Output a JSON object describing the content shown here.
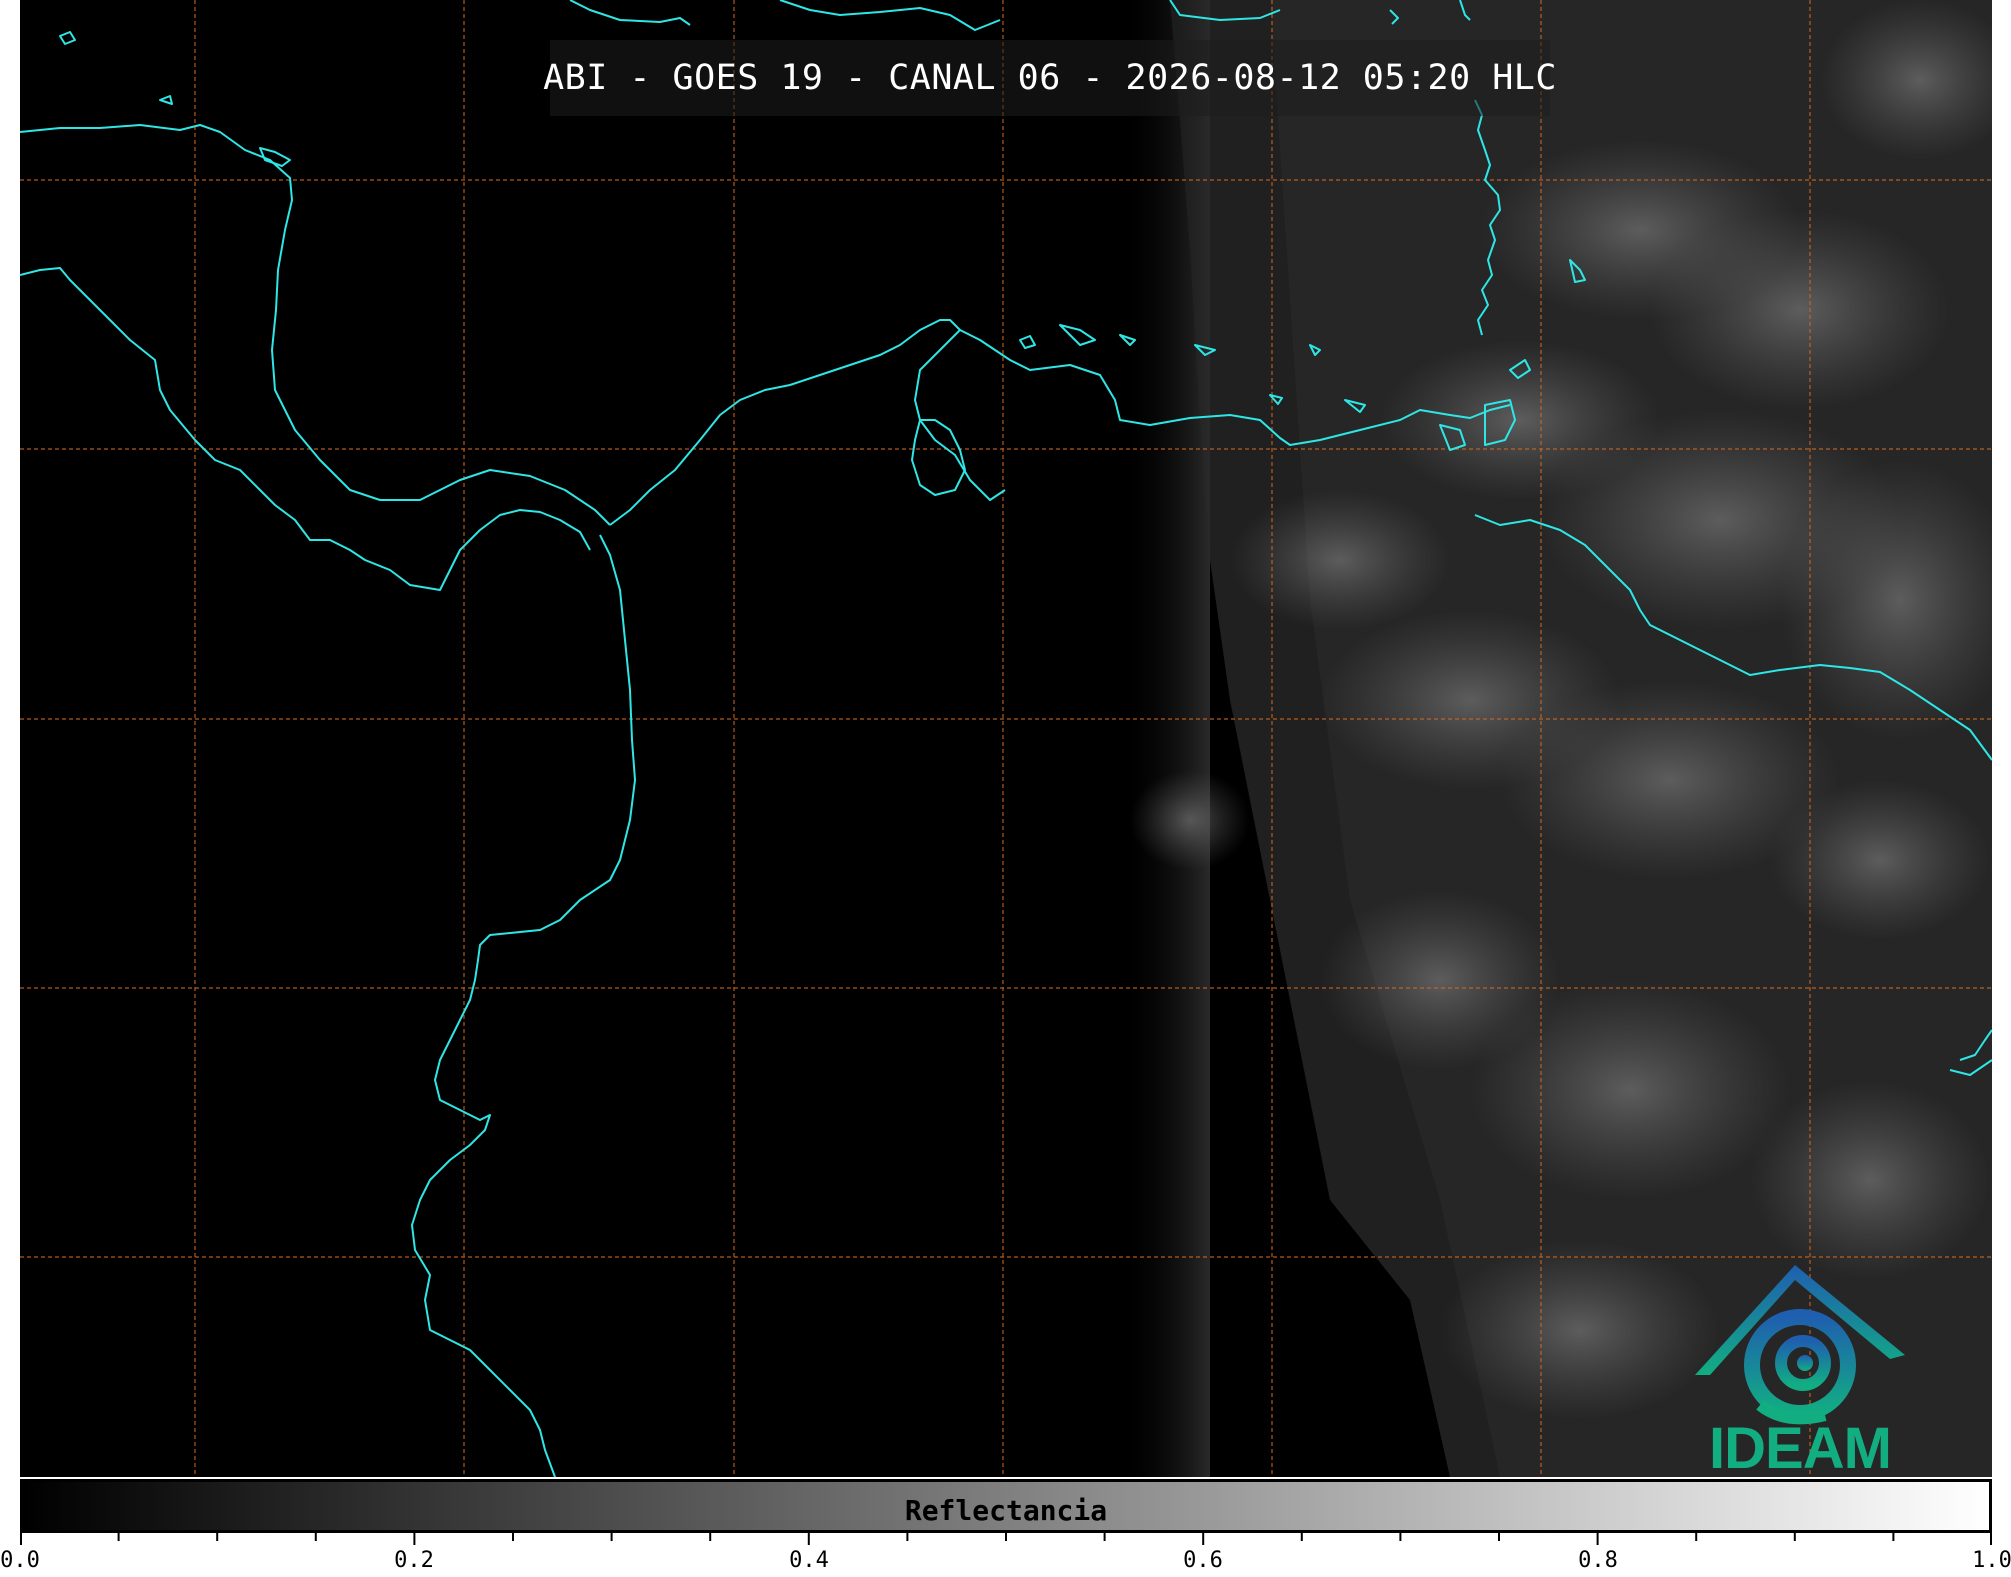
{
  "map": {
    "title": "ABI - GOES 19 - CANAL 06 - 2026-08-12 05:20 HLC",
    "gridline_color": "#d2691e",
    "coastline_color": "#2fe6e6",
    "background_color": "#000000"
  },
  "logo": {
    "text": "IDEAM",
    "text_color": "#12ae82"
  },
  "colorbar": {
    "label": "Reflectancia",
    "min": 0.0,
    "max": 1.0,
    "colormap": [
      "#000000",
      "#ffffff"
    ],
    "major_ticks": [
      "0.0",
      "0.2",
      "0.4",
      "0.6",
      "0.8",
      "1.0"
    ]
  }
}
